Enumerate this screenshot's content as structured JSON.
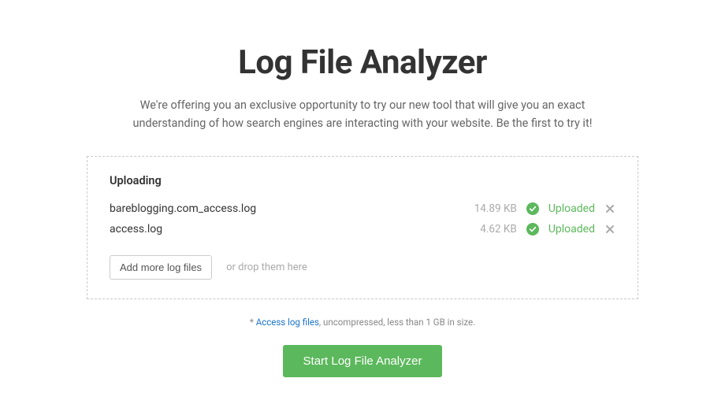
{
  "header": {
    "title": "Log File Analyzer",
    "subtitle": "We're offering you an exclusive opportunity to try our new tool that will give you an exact understanding of how search engines are interacting with your website. Be the first to try it!"
  },
  "upload": {
    "section_label": "Uploading",
    "files": [
      {
        "name": "bareblogging.com_access.log",
        "size": "14.89 KB",
        "status": "Uploaded"
      },
      {
        "name": "access.log",
        "size": "4.62 KB",
        "status": "Uploaded"
      }
    ],
    "add_more_label": "Add more log files",
    "drop_hint": "or drop them here"
  },
  "footnote": {
    "prefix": "* ",
    "link_text": "Access log files",
    "suffix": ", uncompressed, less than 1 GB in size."
  },
  "cta": {
    "label": "Start Log File Analyzer"
  }
}
